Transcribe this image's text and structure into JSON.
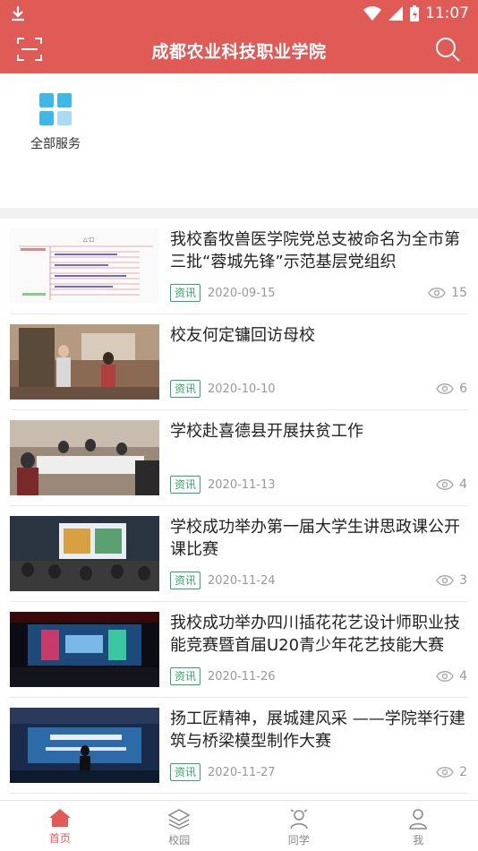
{
  "status": {
    "time": "11:07"
  },
  "app": {
    "title": "成都农业科技职业学院"
  },
  "services": [
    {
      "label": "全部服务",
      "icon": "grid-icon"
    }
  ],
  "news": [
    {
      "title": "我校畜牧兽医学院党总支被命名为全市第三批“蓉城先锋”示范基层党组织",
      "tag": "资讯",
      "date": "2020-09-15",
      "views": "15"
    },
    {
      "title": "校友何定镛回访母校",
      "tag": "资讯",
      "date": "2020-10-10",
      "views": "6"
    },
    {
      "title": "学校赴喜德县开展扶贫工作",
      "tag": "资讯",
      "date": "2020-11-13",
      "views": "4"
    },
    {
      "title": "学校成功举办第一届大学生讲思政课公开课比赛",
      "tag": "资讯",
      "date": "2020-11-24",
      "views": "3"
    },
    {
      "title": "我校成功举办四川插花花艺设计师职业技能竞赛暨首届U20青少年花艺技能大赛",
      "tag": "资讯",
      "date": "2020-11-26",
      "views": "4"
    },
    {
      "title": "扬工匠精神，展城建风采 ——学院举行建筑与桥梁模型制作大赛",
      "tag": "资讯",
      "date": "2020-11-27",
      "views": "2"
    }
  ],
  "tabs": [
    {
      "label": "首页",
      "active": true
    },
    {
      "label": "校园"
    },
    {
      "label": "同学"
    },
    {
      "label": "我"
    }
  ],
  "colors": {
    "brand": "#e05a56",
    "tag": "#2fa86b",
    "service_icon": "#3fb8e6"
  }
}
